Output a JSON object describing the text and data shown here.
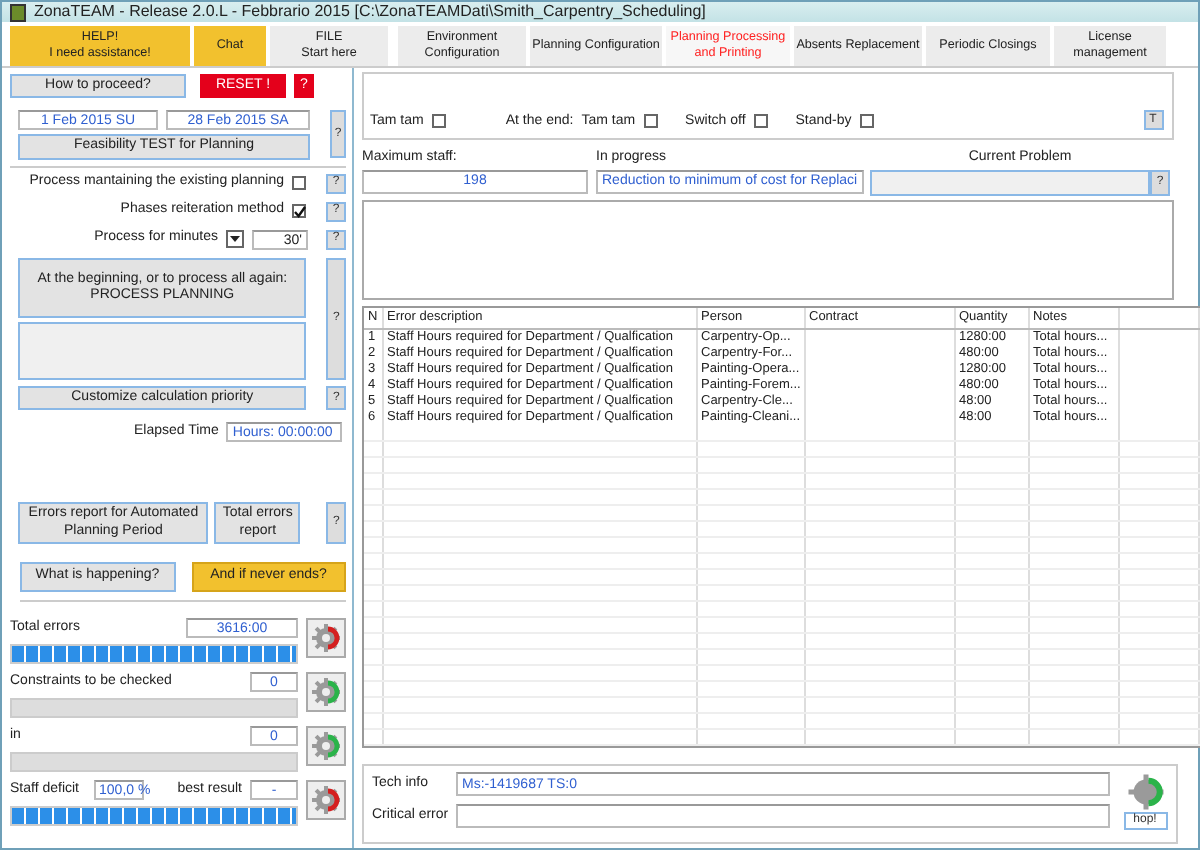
{
  "window": {
    "title": "ZonaTEAM - Release 2.0.L - Febbrario 2015 [C:\\ZonaTEAMDati\\Smith_Carpentry_Scheduling]"
  },
  "tabs": [
    {
      "label": "HELP!\nI need assistance!",
      "kind": "help",
      "selected": false
    },
    {
      "label": "Chat",
      "kind": "help",
      "selected": false
    },
    {
      "label": "FILE\nStart here",
      "kind": "normal",
      "selected": false
    },
    {
      "label": "Environment\nConfiguration",
      "kind": "normal",
      "selected": false
    },
    {
      "label": "Planning Configuration",
      "kind": "normal",
      "selected": false
    },
    {
      "label": "Planning Processing\nand Printing",
      "kind": "normal",
      "selected": true
    },
    {
      "label": "Absents Replacement",
      "kind": "normal",
      "selected": false
    },
    {
      "label": "Periodic Closings",
      "kind": "normal",
      "selected": false
    },
    {
      "label": "License\nmanagement",
      "kind": "normal",
      "selected": false
    }
  ],
  "left": {
    "how_button": "How to proceed?",
    "reset_button": "RESET !",
    "reset_help": "?",
    "date_from": "1 Feb 2015 SU",
    "date_to": "28 Feb 2015 SA",
    "feasibility_button": "Feasibility TEST for Planning",
    "feasibility_help": "?",
    "options": [
      {
        "label": "Process mantaining the existing planning",
        "kind": "checkbox",
        "checked": false,
        "help": "?"
      },
      {
        "label": "Phases reiteration method",
        "kind": "checkbox",
        "checked": true,
        "help": "?"
      },
      {
        "label": "Process for minutes",
        "kind": "dropdown",
        "value": "30'",
        "help": "?"
      }
    ],
    "process_button": "At the beginning, or to process all again:\nPROCESS PLANNING",
    "process_help": "?",
    "customize_button": "Customize calculation priority",
    "customize_help": "?",
    "elapsed_label": "Elapsed Time",
    "elapsed_value": "Hours: 00:00:00",
    "errors_report_button": "Errors report for Automated\nPlanning Period",
    "total_errors_button": "Total errors\nreport",
    "report_help": "?",
    "what_button": "What is happening?",
    "never_ends_button": "And if never ends?",
    "meters": [
      {
        "label": "Total errors",
        "value": "3616:00",
        "level": 1,
        "color": "#d42020"
      },
      {
        "label": "Constraints to be checked",
        "value": "0",
        "level": 0,
        "color": "#2bb34a"
      },
      {
        "label": "in",
        "value": "0",
        "level": 0,
        "color": "#2bb34a"
      },
      {
        "label": "Staff deficit",
        "value": "100,0 %",
        "extra_label": "best result",
        "extra_value": "-",
        "level": 1,
        "color": "#d42020"
      }
    ]
  },
  "alerts": [
    {
      "label": "Tam tam",
      "checked": false
    },
    {
      "prefix": "At the end:",
      "label": "Tam tam",
      "checked": false
    },
    {
      "label": "Switch off",
      "checked": false
    },
    {
      "label": "Stand-by",
      "checked": false
    }
  ],
  "t_button": "T",
  "status": {
    "max_staff_label": "Maximum staff:",
    "max_staff_value": "198",
    "in_progress_label": "In progress",
    "in_progress_value": "Reduction to minimum of cost for Replaci",
    "current_problem_label": "Current Problem",
    "problem_help": "?"
  },
  "table": {
    "columns": [
      "N",
      "Error description",
      "Person",
      "Contract",
      "Quantity",
      "Notes"
    ],
    "rows": [
      [
        "1",
        "Staff Hours required for Department / Qualfication",
        "Carpentry-Op...",
        "",
        "1280:00",
        "Total hours..."
      ],
      [
        "2",
        "Staff Hours required for Department / Qualfication",
        "Carpentry-For...",
        "",
        "480:00",
        "Total hours..."
      ],
      [
        "3",
        "Staff Hours required for Department / Qualfication",
        "Painting-Opera...",
        "",
        "1280:00",
        "Total hours..."
      ],
      [
        "4",
        "Staff Hours required for Department / Qualfication",
        "Painting-Forem...",
        "",
        "480:00",
        "Total hours..."
      ],
      [
        "5",
        "Staff Hours required for Department / Qualfication",
        "Carpentry-Cle...",
        "",
        "48:00",
        "Total hours..."
      ],
      [
        "6",
        "Staff Hours required for Department / Qualfication",
        "Painting-Cleani...",
        "",
        "48:00",
        "Total hours..."
      ]
    ]
  },
  "tech": {
    "tech_info_label": "Tech info",
    "tech_info_value": "Ms:-1419687 TS:0",
    "critical_error_label": "Critical error",
    "hop_button": "hop!"
  }
}
